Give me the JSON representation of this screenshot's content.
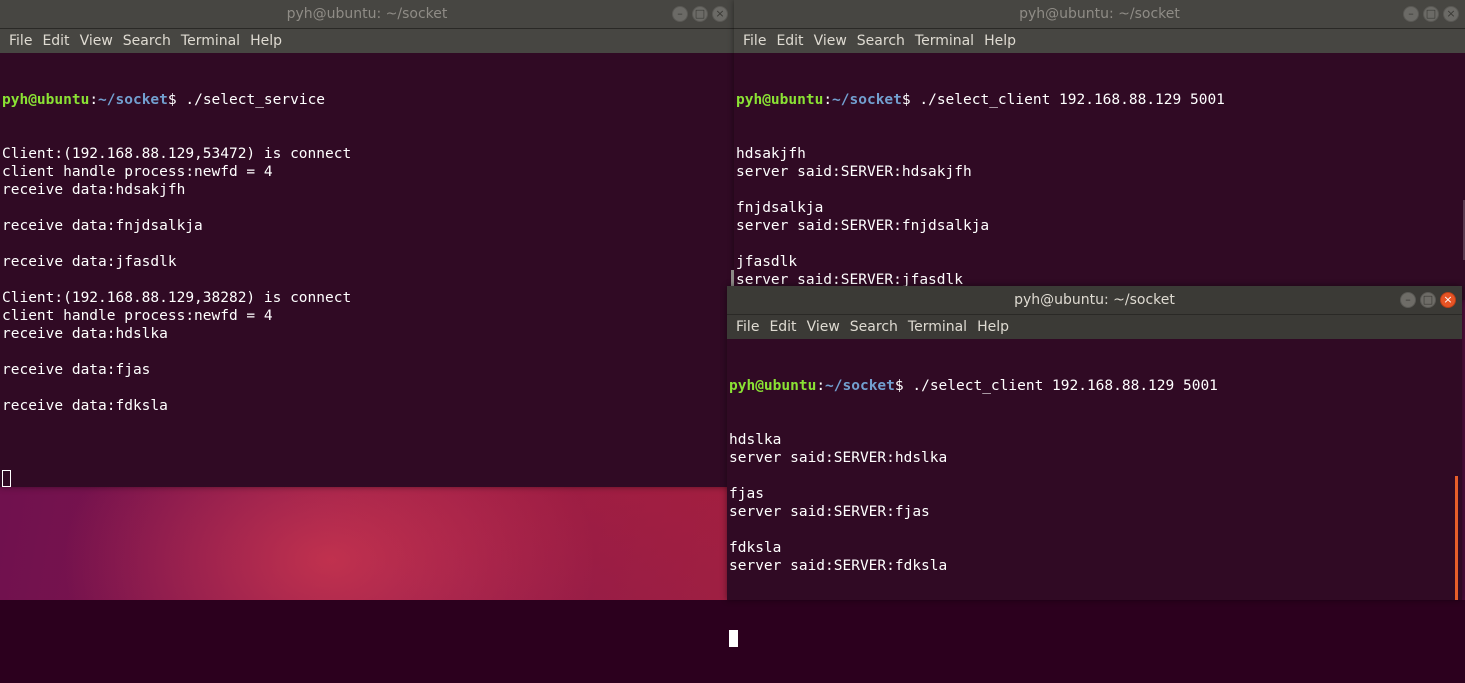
{
  "windows": {
    "server": {
      "title": "pyh@ubuntu: ~/socket",
      "menu": [
        "File",
        "Edit",
        "View",
        "Search",
        "Terminal",
        "Help"
      ],
      "prompt_user": "pyh@ubuntu",
      "prompt_sep": ":",
      "prompt_path": "~/socket",
      "prompt_end": "$ ",
      "command": "./select_service",
      "output": [
        "Client:(192.168.88.129,53472) is connect",
        "client handle process:newfd = 4",
        "receive data:hdsakjfh",
        "",
        "receive data:fnjdsalkja",
        "",
        "receive data:jfasdlk",
        "",
        "Client:(192.168.88.129,38282) is connect",
        "client handle process:newfd = 4",
        "receive data:hdslka",
        "",
        "receive data:fjas",
        "",
        "receive data:fdksla",
        ""
      ]
    },
    "client1": {
      "title": "pyh@ubuntu: ~/socket",
      "menu": [
        "File",
        "Edit",
        "View",
        "Search",
        "Terminal",
        "Help"
      ],
      "prompt_user": "pyh@ubuntu",
      "prompt_sep": ":",
      "prompt_path": "~/socket",
      "prompt_end": "$ ",
      "command": "./select_client 192.168.88.129 5001",
      "output": [
        "hdsakjfh",
        "server said:SERVER:hdsakjfh",
        "",
        "fnjdsalkja",
        "server said:SERVER:fnjdsalkja",
        "",
        "jfasdlk",
        "server said:SERVER:jfasdlk",
        ""
      ]
    },
    "client2": {
      "title": "pyh@ubuntu: ~/socket",
      "menu": [
        "File",
        "Edit",
        "View",
        "Search",
        "Terminal",
        "Help"
      ],
      "prompt_user": "pyh@ubuntu",
      "prompt_sep": ":",
      "prompt_path": "~/socket",
      "prompt_end": "$ ",
      "command": "./select_client 192.168.88.129 5001",
      "output": [
        "hdslka",
        "server said:SERVER:hdslka",
        "",
        "fjas",
        "server said:SERVER:fjas",
        "",
        "fdksla",
        "server said:SERVER:fdksla",
        ""
      ]
    }
  },
  "icons": {
    "minimize": "minimize-icon",
    "maximize": "maximize-icon",
    "close": "close-icon"
  },
  "colors": {
    "terminal_bg": "#300a24",
    "prompt_user": "#8ae234",
    "prompt_path": "#729fcf",
    "close_active": "#e75425"
  }
}
